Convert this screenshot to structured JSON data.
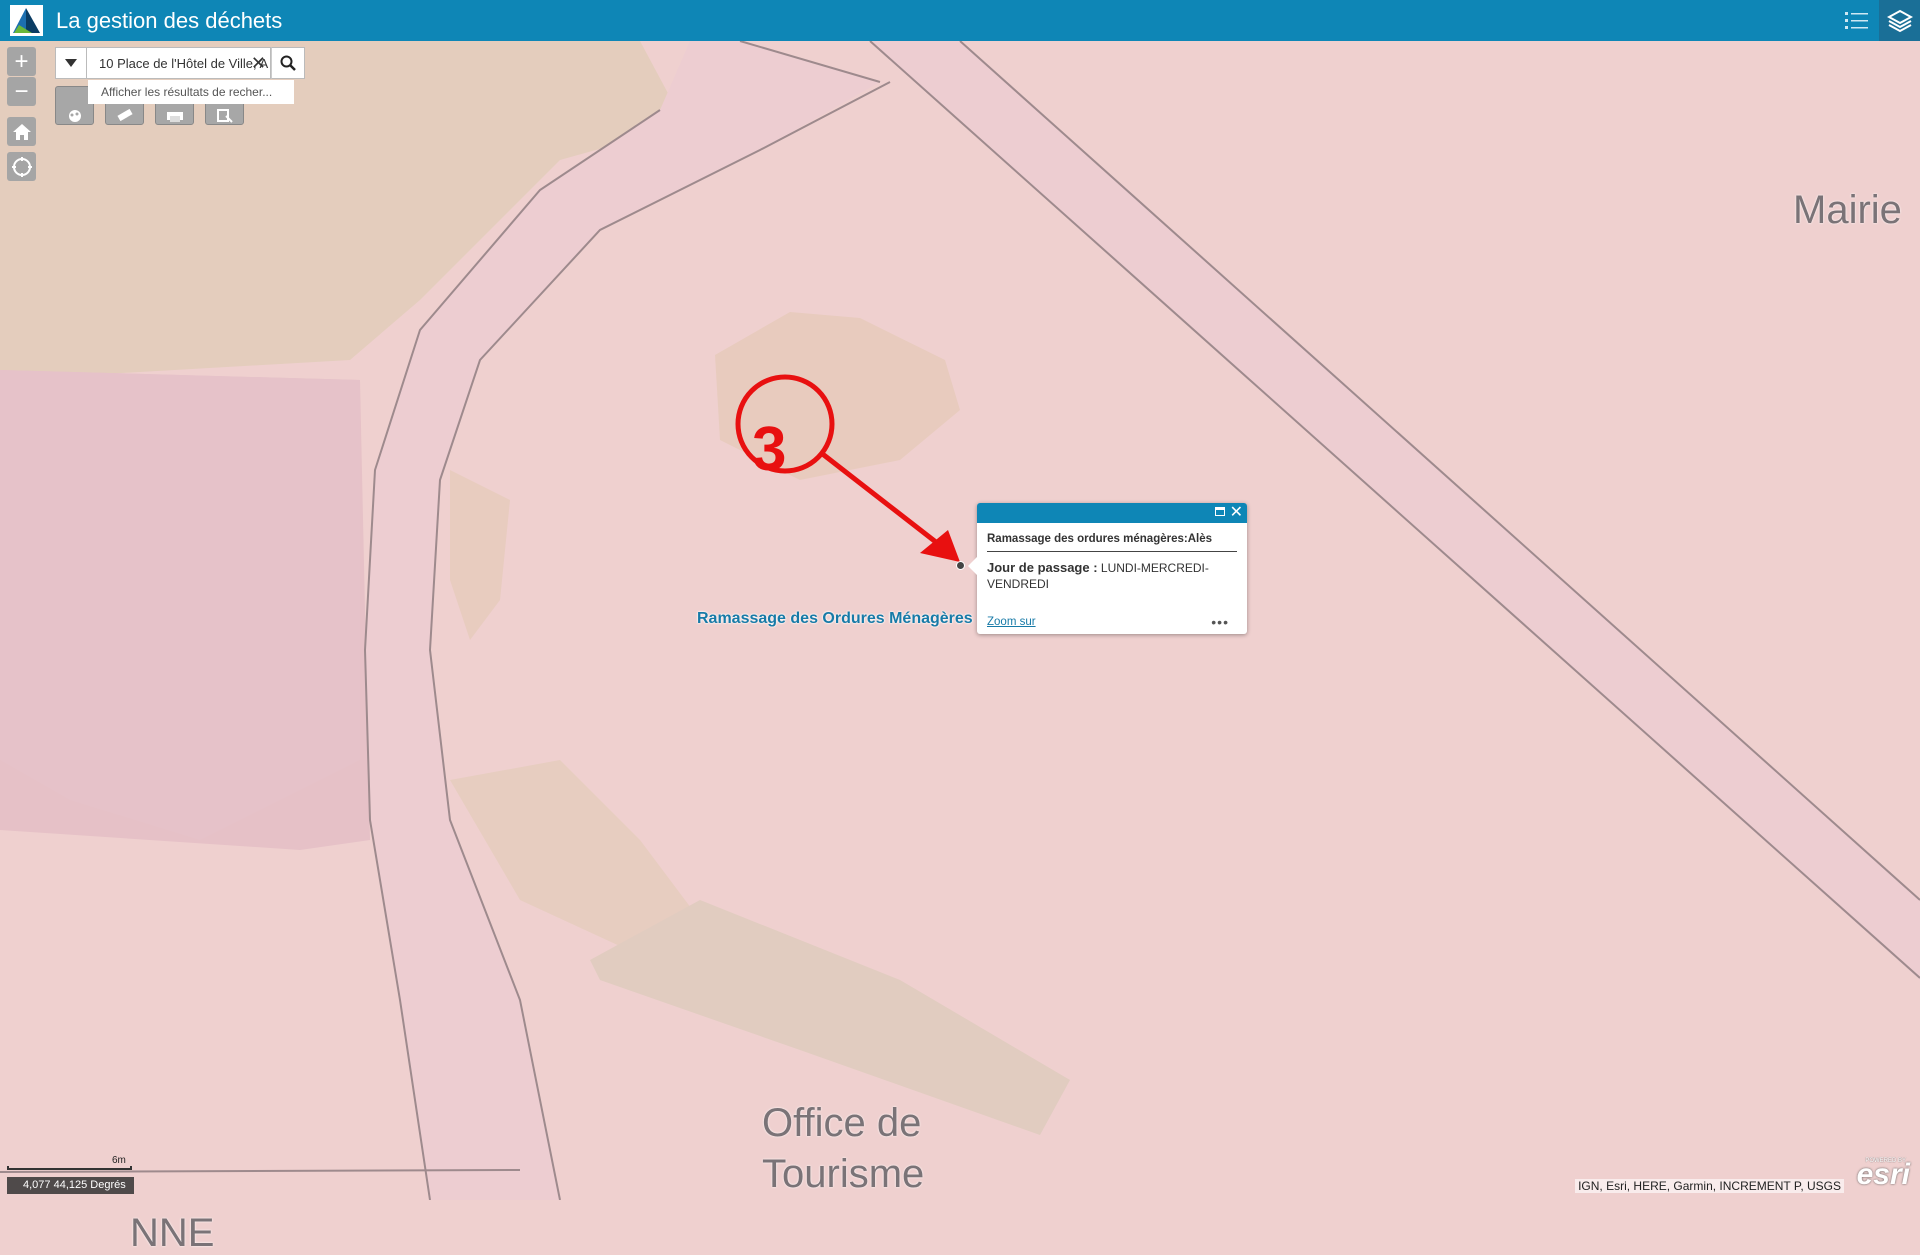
{
  "header": {
    "title": "La gestion des déchets",
    "icons": [
      "app-logo",
      "legend-list-icon",
      "layers-icon"
    ]
  },
  "nav": {
    "zoom_in": "+",
    "zoom_out": "−",
    "icons": [
      "home-icon",
      "locate-icon"
    ]
  },
  "search": {
    "value": "10 Place de l'Hôtel de Ville, A",
    "suggestion": "Afficher les résultats de recher...",
    "icons": [
      "dropdown-arrow-icon",
      "clear-icon",
      "search-icon"
    ]
  },
  "tools": {
    "icons": [
      "basemap-icon",
      "measure-icon",
      "print-icon",
      "query-icon"
    ]
  },
  "map": {
    "labels": {
      "mairie": "Mairie",
      "office_line1": "Office de",
      "office_line2": "Tourisme",
      "street_partial": "NNE"
    },
    "feature_label": "Ramassage des Ordures Ménagères",
    "annotation_number": "3",
    "colors": {
      "background": "#efd0cf",
      "accent": "#0e86b6",
      "annotation": "#e81010"
    }
  },
  "popup": {
    "title": "Ramassage des ordures ménagères:Alès",
    "field_label": "Jour de passage :",
    "field_value": "LUNDI-MERCREDI-VENDREDI",
    "zoom_link": "Zoom sur",
    "more": "•••"
  },
  "footer": {
    "scale": "6m",
    "coordinates": "4,077 44,125 Degrés",
    "attribution": "IGN, Esri, HERE, Garmin, INCREMENT P, USGS",
    "esri_powered": "POWERED BY",
    "esri_logo": "esri"
  }
}
